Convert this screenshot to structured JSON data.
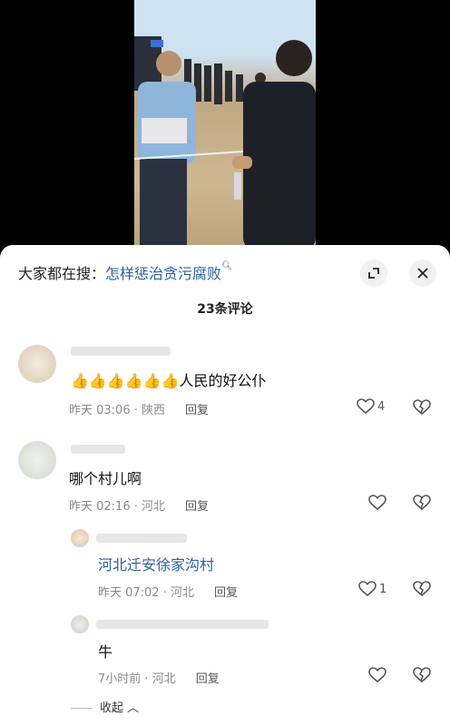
{
  "search": {
    "prefix": "大家都在搜：",
    "keyword": "怎样惩治贪污腐败",
    "icon": "search-icon"
  },
  "header": {
    "comment_count": "23条评论"
  },
  "comments": [
    {
      "text": "👍👍👍👍👍👍人民的好公仆",
      "time": "昨天 03:06",
      "location": "陕西",
      "reply": "回复",
      "likes": "4"
    },
    {
      "text": "哪个村儿啊",
      "time": "昨天 02:16",
      "location": "河北",
      "reply": "回复",
      "likes": ""
    }
  ],
  "replies": [
    {
      "text": "河北迁安徐家沟村",
      "time": "昨天 07:02",
      "location": "河北",
      "reply": "回复",
      "likes": "1"
    },
    {
      "text": "牛",
      "time": "7小时前",
      "location": "河北",
      "reply": "回复",
      "likes": ""
    }
  ],
  "collapse_label": "收起",
  "colors": {
    "link": "#2c5f9e",
    "meta": "#8a8a8a"
  }
}
